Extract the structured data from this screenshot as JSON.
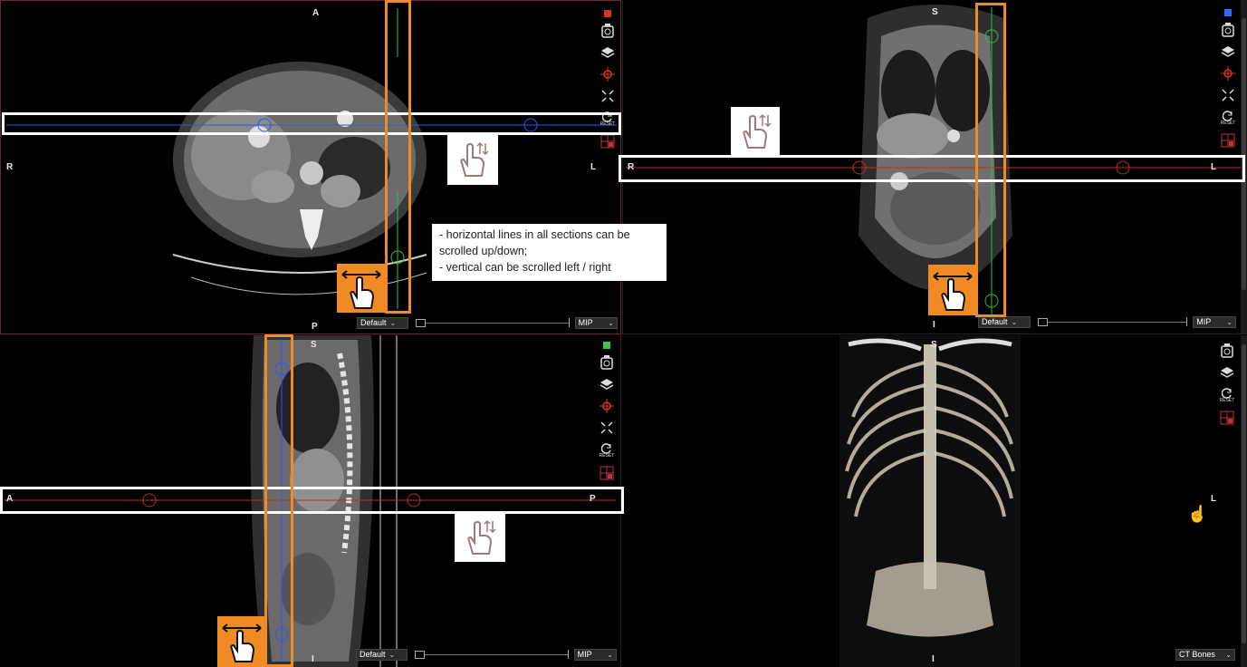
{
  "viewports": {
    "axial": {
      "orientation": {
        "top": "A",
        "left": "R",
        "right": "L",
        "bottom": "P"
      },
      "indicator_color": "#d9341f",
      "window_preset": "Default",
      "render_mode": "MIP"
    },
    "coronal": {
      "orientation": {
        "top": "S",
        "left": "R",
        "right": "L",
        "bottom": "I"
      },
      "indicator_color": "#2f6bff",
      "window_preset": "Default",
      "render_mode": "MIP"
    },
    "sagittal": {
      "orientation": {
        "top": "S",
        "left": "A",
        "right": "P",
        "bottom": "I"
      },
      "indicator_color": "#3ec43e",
      "window_preset": "Default",
      "render_mode": "MIP"
    },
    "volume3d": {
      "orientation": {
        "top": "S",
        "right": "L",
        "bottom": "I"
      },
      "preset": "CT Bones"
    }
  },
  "tools": {
    "reset_label": "RESET",
    "icons": [
      "camera-icon",
      "layers-icon",
      "crosshair-icon",
      "collapse-icon",
      "reset-icon",
      "layout-icon"
    ]
  },
  "annotation": {
    "line1": "- horizontal lines in all sections can be",
    "line2": "scrolled up/down;",
    "line3": "- vertical can be scrolled left / right"
  },
  "colors": {
    "annotation_horizontal": "#ffffff",
    "annotation_vertical": "#f08a24",
    "crosshair_blue": "#2f54ff",
    "crosshair_green": "#2ebf3a",
    "crosshair_red": "#b8321f"
  }
}
